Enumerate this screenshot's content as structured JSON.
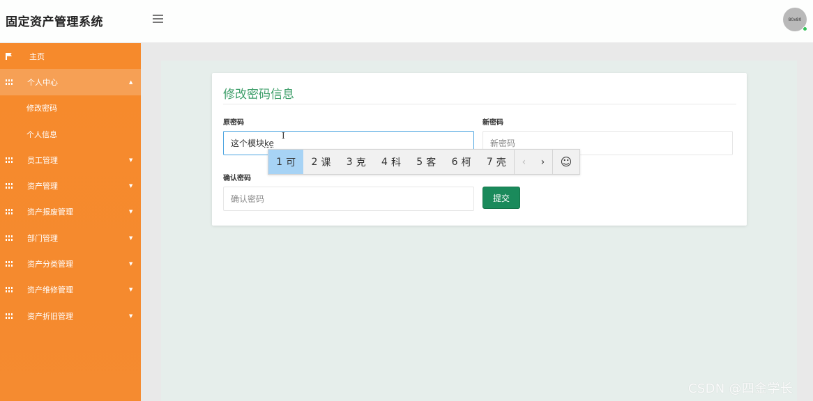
{
  "header": {
    "app_title": "固定资产管理系统",
    "avatar_text": "80x80"
  },
  "sidebar": {
    "items": [
      {
        "label": "主页",
        "icon": "flag-icon"
      },
      {
        "label": "个人中心",
        "icon": "grid-icon",
        "expanded": true,
        "caret": "▲"
      },
      {
        "label": "修改密码",
        "sub": true
      },
      {
        "label": "个人信息",
        "sub": true
      },
      {
        "label": "员工管理",
        "icon": "grid-icon",
        "caret": "▼"
      },
      {
        "label": "资产管理",
        "icon": "grid-icon",
        "caret": "▼"
      },
      {
        "label": "资产报废管理",
        "icon": "grid-icon",
        "caret": "▼"
      },
      {
        "label": "部门管理",
        "icon": "grid-icon",
        "caret": "▼"
      },
      {
        "label": "资产分类管理",
        "icon": "grid-icon",
        "caret": "▼"
      },
      {
        "label": "资产维修管理",
        "icon": "grid-icon",
        "caret": "▼"
      },
      {
        "label": "资产折旧管理",
        "icon": "grid-icon",
        "caret": "▼"
      }
    ],
    "color": "#f68a2c"
  },
  "form": {
    "title": "修改密码信息",
    "old_password": {
      "label": "原密码",
      "value": "这个模块",
      "composing": "ke"
    },
    "new_password": {
      "label": "新密码",
      "placeholder": "新密码"
    },
    "confirm_password": {
      "label": "确认密码",
      "placeholder": "确认密码"
    },
    "submit_label": "提交",
    "accent_color": "#3d9e69",
    "button_color": "#1a8a5b"
  },
  "ime": {
    "candidates": [
      {
        "num": "1",
        "text": "可"
      },
      {
        "num": "2",
        "text": "课"
      },
      {
        "num": "3",
        "text": "克"
      },
      {
        "num": "4",
        "text": "科"
      },
      {
        "num": "5",
        "text": "客"
      },
      {
        "num": "6",
        "text": "柯"
      },
      {
        "num": "7",
        "text": "壳"
      }
    ],
    "prev": "‹",
    "next": "›",
    "emoji": "☺"
  },
  "watermark": "CSDN @四金学长"
}
